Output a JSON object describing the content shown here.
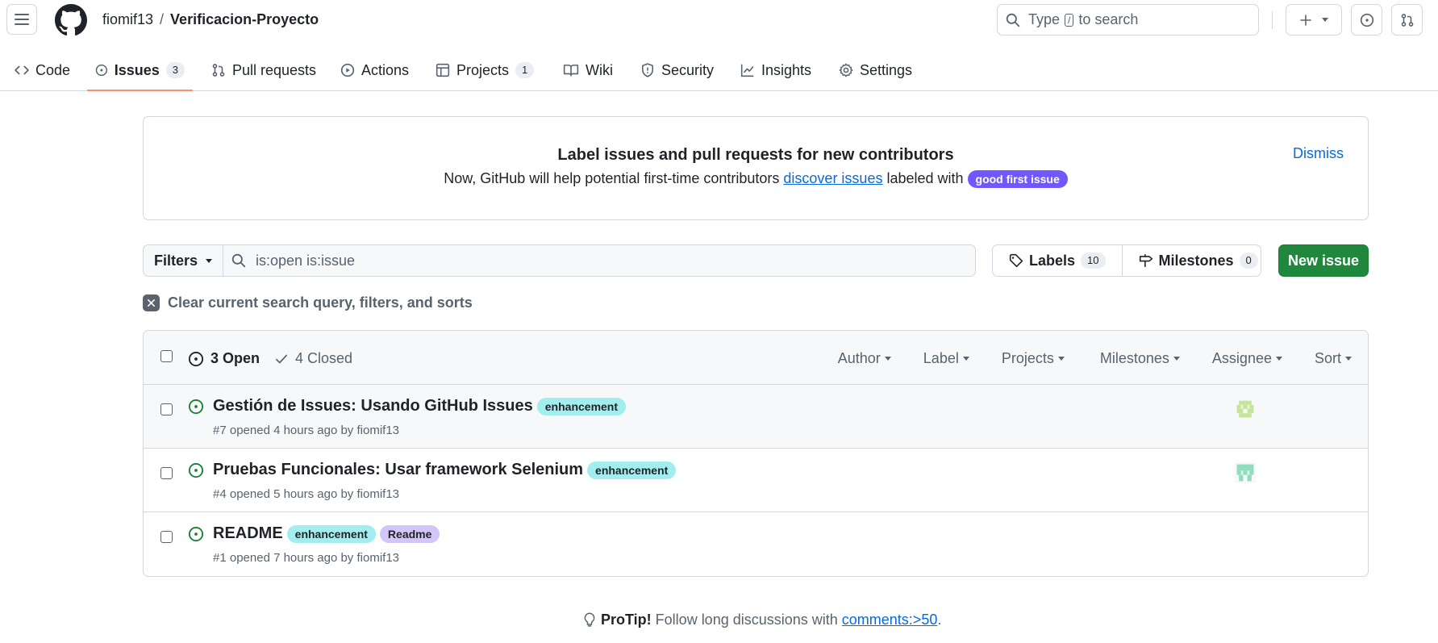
{
  "header": {
    "owner": "fiomif13",
    "separator": "/",
    "repo": "Verificacion-Proyecto",
    "search": {
      "prefix": "Type",
      "key": "/",
      "suffix": "to search"
    }
  },
  "tabs": [
    {
      "label": "Code"
    },
    {
      "label": "Issues",
      "count": "3"
    },
    {
      "label": "Pull requests"
    },
    {
      "label": "Actions"
    },
    {
      "label": "Projects",
      "count": "1"
    },
    {
      "label": "Wiki"
    },
    {
      "label": "Security"
    },
    {
      "label": "Insights"
    },
    {
      "label": "Settings"
    }
  ],
  "banner": {
    "title": "Label issues and pull requests for new contributors",
    "text_before": "Now, GitHub will help potential first-time contributors ",
    "link": "discover issues",
    "text_after": " labeled with ",
    "label": "good first issue",
    "dismiss": "Dismiss"
  },
  "toolbar": {
    "filters": "Filters",
    "query": "is:open is:issue",
    "labels": "Labels",
    "labels_count": "10",
    "milestones": "Milestones",
    "milestones_count": "0",
    "new_issue": "New issue",
    "clear": "Clear current search query, filters, and sorts"
  },
  "list_header": {
    "open": "3 Open",
    "closed": "4 Closed",
    "filters": [
      "Author",
      "Label",
      "Projects",
      "Milestones",
      "Assignee",
      "Sort"
    ]
  },
  "issues": [
    {
      "title": "Gestión de Issues: Usando GitHub Issues",
      "labels": [
        "enhancement"
      ],
      "meta": "#7 opened 4 hours ago by fiomif13",
      "has_assignee": true
    },
    {
      "title": "Pruebas Funcionales: Usar framework Selenium",
      "labels": [
        "enhancement"
      ],
      "meta": "#4 opened 5 hours ago by fiomif13",
      "has_assignee": true
    },
    {
      "title": "README",
      "labels": [
        "enhancement",
        "Readme"
      ],
      "meta": "#1 opened 7 hours ago by fiomif13",
      "has_assignee": false
    }
  ],
  "protip": {
    "bold": "ProTip!",
    "text": " Follow long discussions with ",
    "link": "comments:>50",
    "end": "."
  },
  "colors": {
    "accent": "#1f883d",
    "link": "#0969da",
    "open": "#1a7f37",
    "underline": "#fd8c73",
    "enhancement": "#a2eeef",
    "readme": "#d4c5f9",
    "good_first_issue": "#7057ff"
  }
}
